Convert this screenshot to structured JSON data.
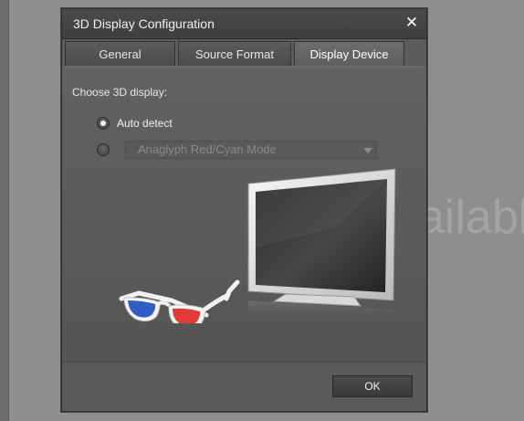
{
  "background": {
    "partial_text": "ailable"
  },
  "dialog": {
    "title": "3D Display Configuration",
    "close_label": "✕",
    "tabs": [
      {
        "label": "General",
        "active": false
      },
      {
        "label": "Source Format",
        "active": false
      },
      {
        "label": "Display Device",
        "active": true
      }
    ],
    "choose_label": "Choose 3D display:",
    "options": {
      "auto_detect": {
        "label": "Auto detect",
        "selected": true
      },
      "manual": {
        "selected": false,
        "select_value": "Anaglyph Red/Cyan Mode",
        "disabled": true
      }
    },
    "ok_label": "OK"
  },
  "colors": {
    "glasses_red": "#e23a36",
    "glasses_blue": "#2f5fc4",
    "dialog_bg": "#5d5d5d"
  }
}
